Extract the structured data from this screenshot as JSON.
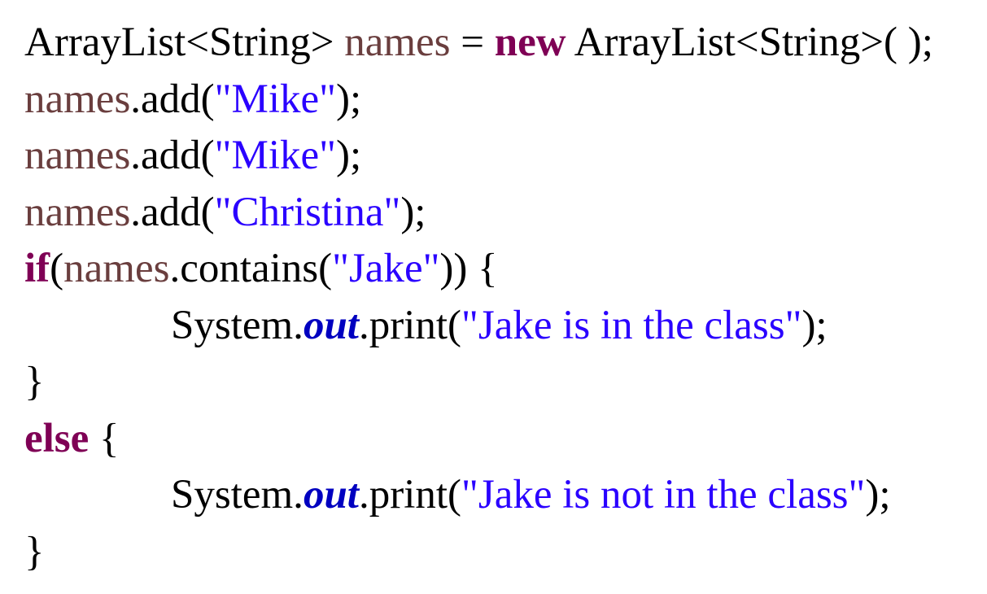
{
  "code_lines": [
    {
      "tokens": [
        {
          "text": "ArrayList<String> ",
          "type": "plain"
        },
        {
          "text": "names",
          "type": "var"
        },
        {
          "text": " = ",
          "type": "plain"
        },
        {
          "text": "new",
          "type": "kw"
        },
        {
          "text": " ArrayList<String>( );",
          "type": "plain"
        }
      ]
    },
    {
      "tokens": [
        {
          "text": "names",
          "type": "var"
        },
        {
          "text": ".add(",
          "type": "plain"
        },
        {
          "text": "\"Mike\"",
          "type": "str"
        },
        {
          "text": ");",
          "type": "plain"
        }
      ]
    },
    {
      "tokens": [
        {
          "text": "names",
          "type": "var"
        },
        {
          "text": ".add(",
          "type": "plain"
        },
        {
          "text": "\"Mike\"",
          "type": "str"
        },
        {
          "text": ");",
          "type": "plain"
        }
      ]
    },
    {
      "tokens": [
        {
          "text": "names",
          "type": "var"
        },
        {
          "text": ".add(",
          "type": "plain"
        },
        {
          "text": "\"Christina\"",
          "type": "str"
        },
        {
          "text": ");",
          "type": "plain"
        }
      ]
    },
    {
      "tokens": [
        {
          "text": "if",
          "type": "kw"
        },
        {
          "text": "(",
          "type": "plain"
        },
        {
          "text": "names",
          "type": "var"
        },
        {
          "text": ".contains(",
          "type": "plain"
        },
        {
          "text": "\"Jake\"",
          "type": "str"
        },
        {
          "text": ")) {",
          "type": "plain"
        }
      ]
    },
    {
      "indent": true,
      "tokens": [
        {
          "text": "System.",
          "type": "plain"
        },
        {
          "text": "out",
          "type": "field"
        },
        {
          "text": ".print(",
          "type": "plain"
        },
        {
          "text": "\"Jake is in the class\"",
          "type": "str"
        },
        {
          "text": ");",
          "type": "plain"
        }
      ]
    },
    {
      "tokens": [
        {
          "text": "}",
          "type": "plain"
        }
      ]
    },
    {
      "tokens": [
        {
          "text": "else",
          "type": "kw"
        },
        {
          "text": " {",
          "type": "plain"
        }
      ]
    },
    {
      "indent": true,
      "tokens": [
        {
          "text": "System.",
          "type": "plain"
        },
        {
          "text": "out",
          "type": "field"
        },
        {
          "text": ".print(",
          "type": "plain"
        },
        {
          "text": "\"Jake is not in the class\"",
          "type": "str"
        },
        {
          "text": ");",
          "type": "plain"
        }
      ]
    },
    {
      "tokens": [
        {
          "text": "}",
          "type": "plain"
        }
      ]
    }
  ]
}
